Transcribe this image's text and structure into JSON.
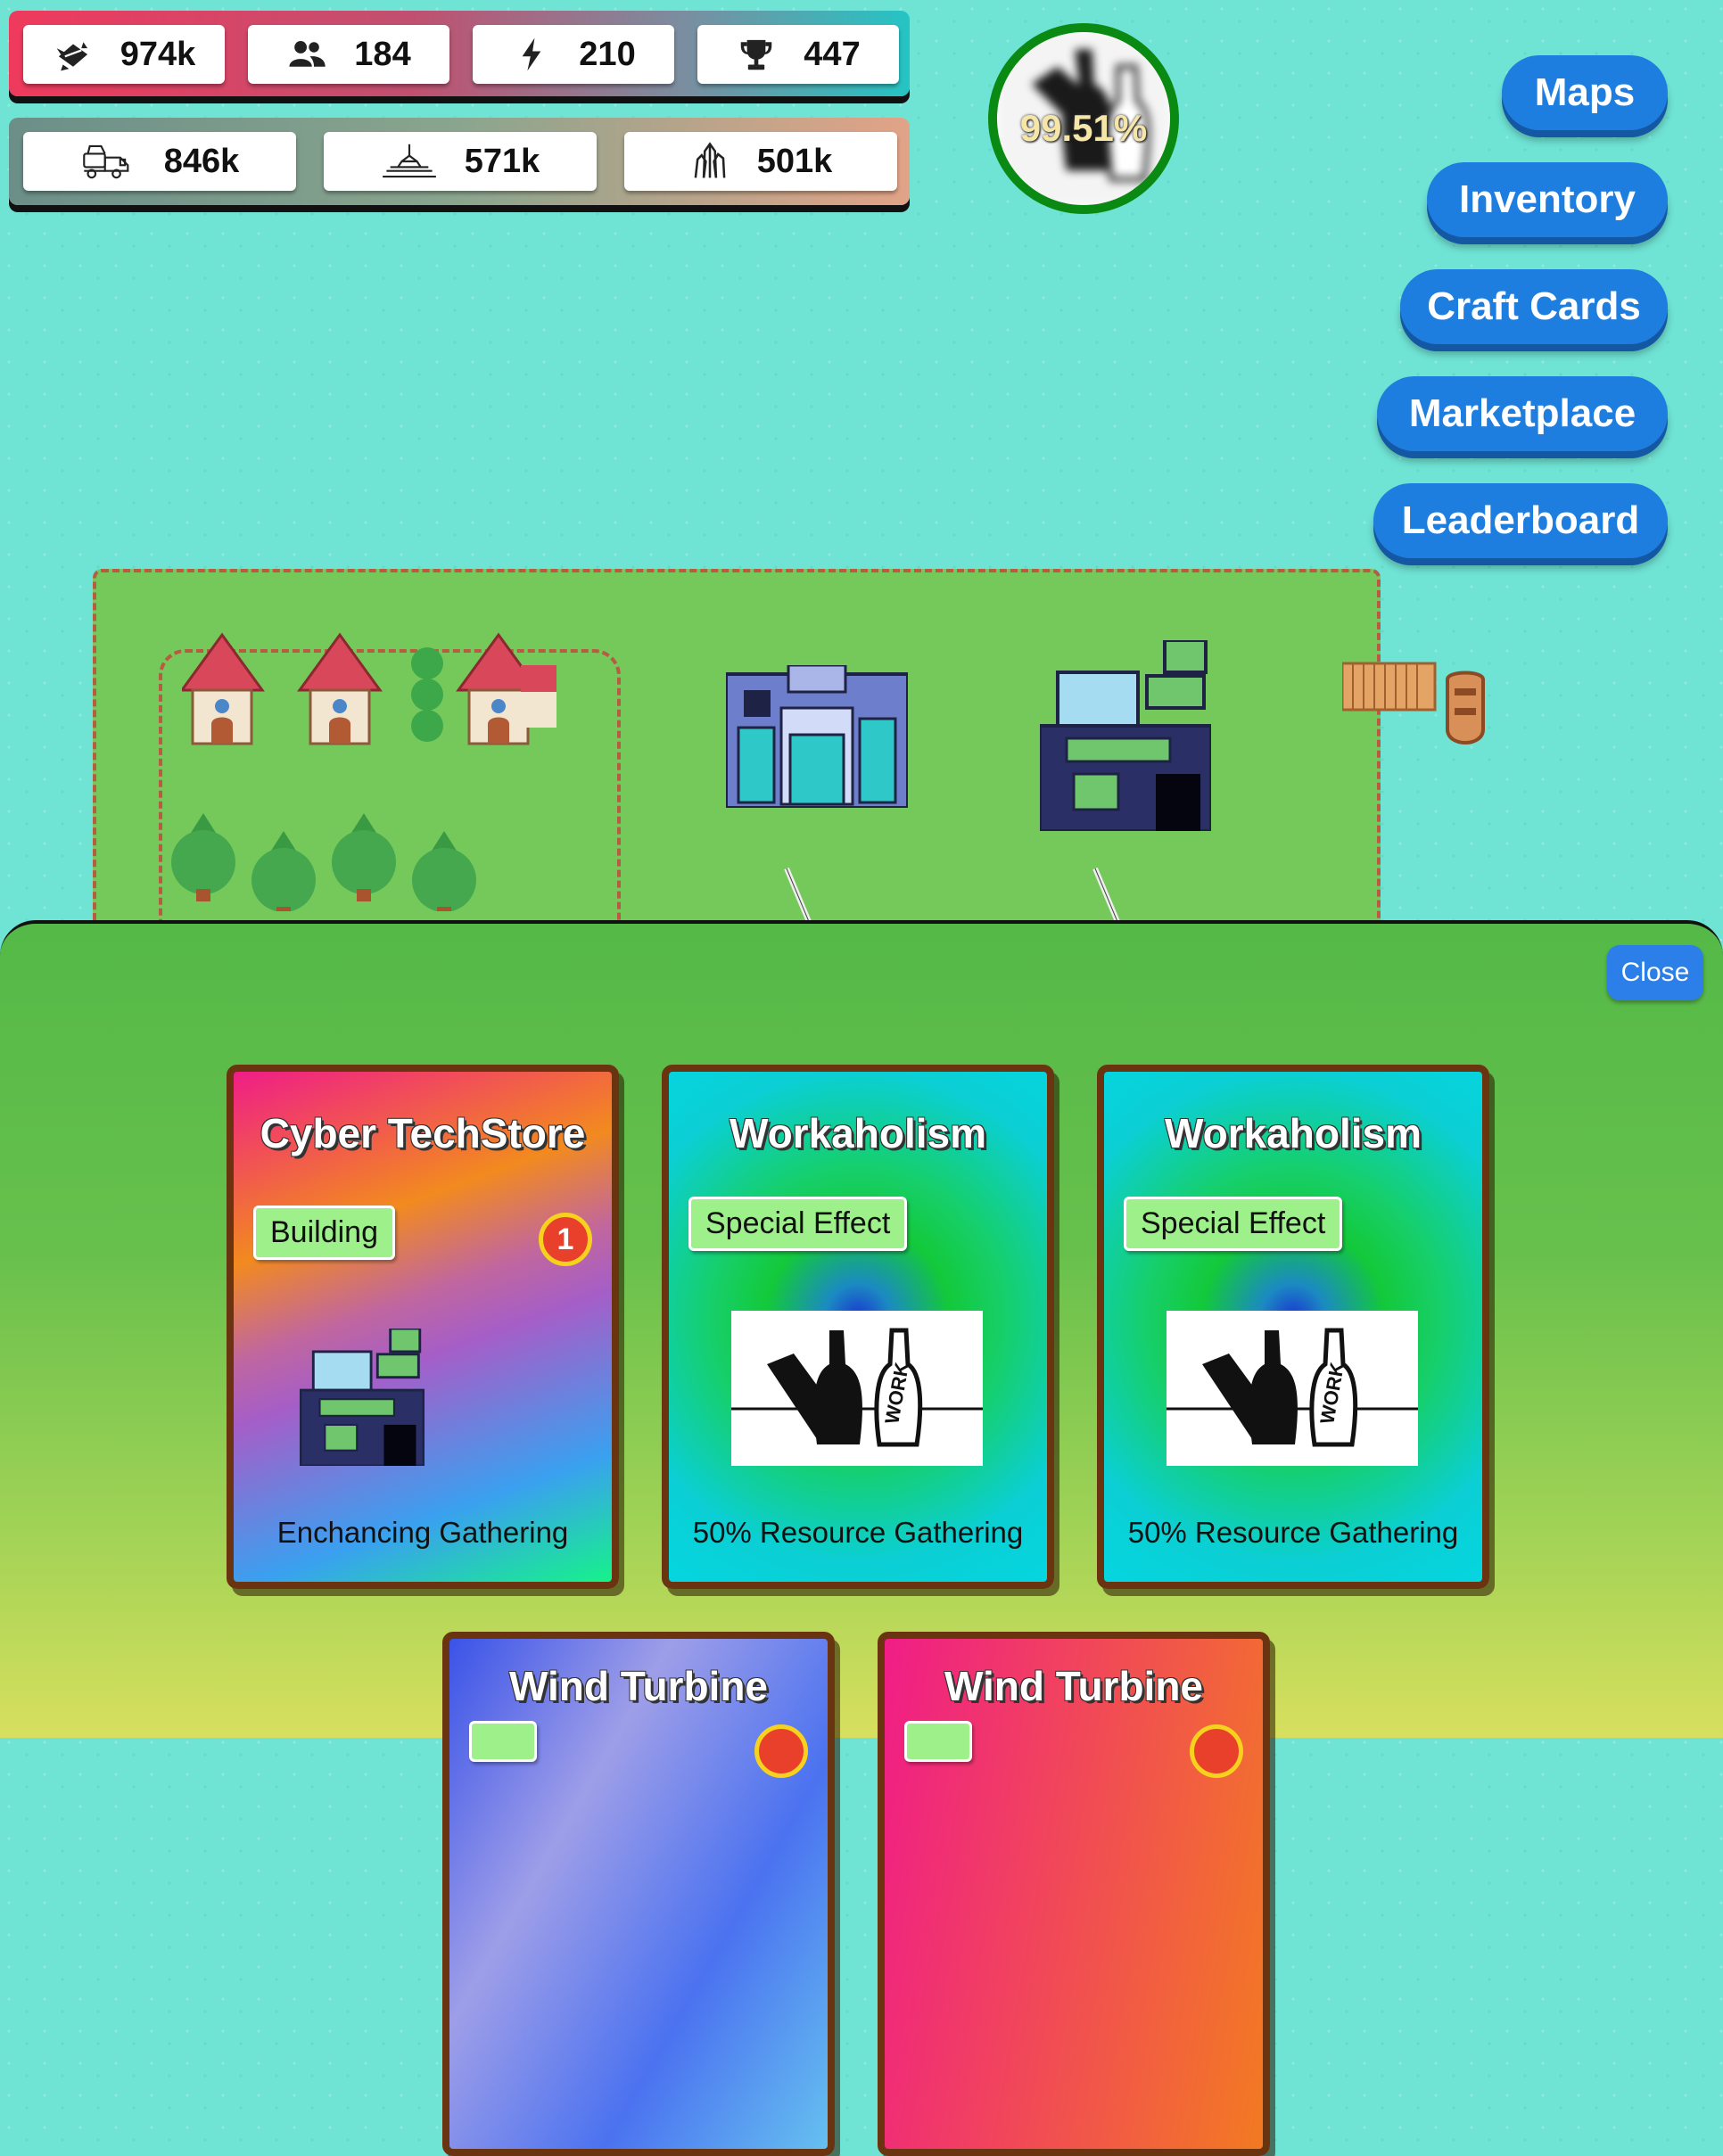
{
  "stats": {
    "row1": [
      {
        "icon": "materials-icon",
        "value": "974k"
      },
      {
        "icon": "population-icon",
        "value": "184"
      },
      {
        "icon": "energy-icon",
        "value": "210"
      },
      {
        "icon": "trophy-icon",
        "value": "447"
      }
    ],
    "row2": [
      {
        "icon": "cement-truck-icon",
        "value": "846k"
      },
      {
        "icon": "crane-icon",
        "value": "571k"
      },
      {
        "icon": "crystal-icon",
        "value": "501k"
      }
    ]
  },
  "progress": {
    "percent_label": "99.51%",
    "value": 99.51
  },
  "menu": {
    "maps": "Maps",
    "inventory": "Inventory",
    "craft_cards": "Craft Cards",
    "marketplace": "Marketplace",
    "leaderboard": "Leaderboard"
  },
  "panel": {
    "close_label": "Close",
    "cards": [
      {
        "title": "Cyber TechStore",
        "tag": "Building",
        "badge": "1",
        "desc": "Enchancing Gathering"
      },
      {
        "title": "Workaholism",
        "tag": "Special Effect",
        "desc": "50% Resource Gathering",
        "image_text": "WORK"
      },
      {
        "title": "Workaholism",
        "tag": "Special Effect",
        "desc": "50% Resource Gathering",
        "image_text": "WORK"
      },
      {
        "title": "Wind Turbine"
      },
      {
        "title": "Wind Turbine"
      }
    ]
  },
  "colors": {
    "water": "#6fe3d4",
    "grass": "#74c95a",
    "menu_button": "#1e7ee0",
    "progress_ring": "#0b8a13",
    "card_border": "#6a3410"
  }
}
